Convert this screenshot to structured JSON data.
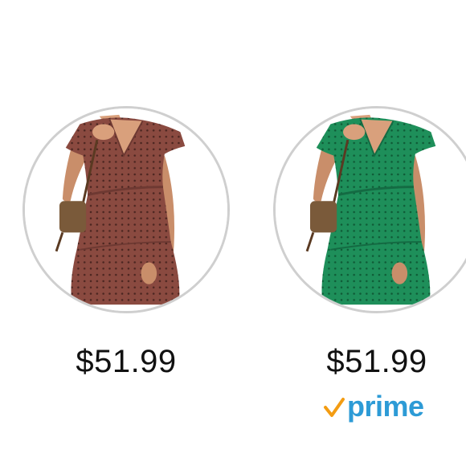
{
  "colors": {
    "variant_1": "#8a4a40",
    "variant_2": "#1e8f5a",
    "prime_blue": "#2d9bd6",
    "prime_check": "#f39c12"
  },
  "variants": [
    {
      "image_icon": "dress-rust-red-swatch",
      "price": "$51.99",
      "prime": false
    },
    {
      "image_icon": "dress-green-swatch",
      "price": "$51.99",
      "prime": true,
      "prime_label": "prime"
    }
  ]
}
